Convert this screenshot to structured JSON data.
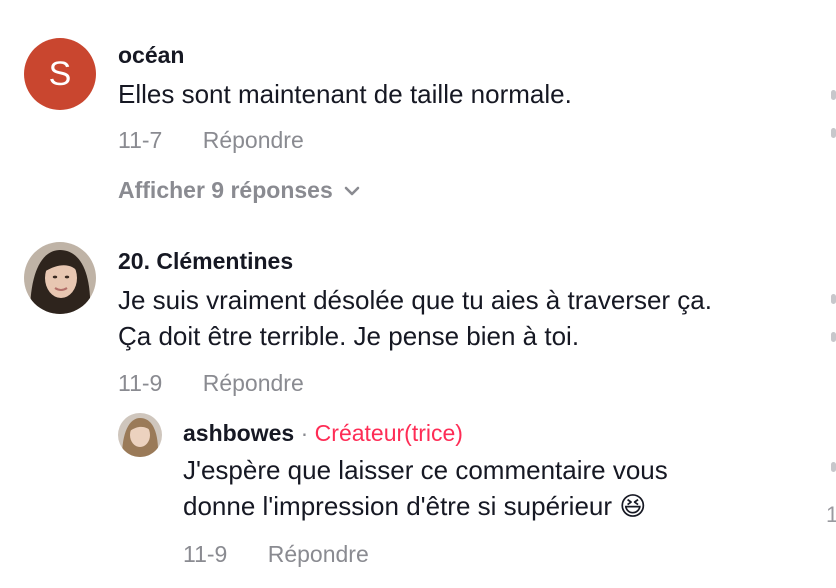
{
  "comments": [
    {
      "avatar_letter": "S",
      "username": "océan",
      "text": "Elles sont maintenant de taille normale.",
      "date": "11-7",
      "reply_label": "Répondre",
      "view_replies": "Afficher 9 réponses"
    },
    {
      "username": "20. Clémentines",
      "text_lines": [
        "Je suis vraiment désolée que tu aies à traverser ça.",
        "Ça doit être terrible. Je pense bien à toi."
      ],
      "date": "11-9",
      "reply_label": "Répondre",
      "reply": {
        "username": "ashbowes",
        "separator": "·",
        "badge": "Créateur(trice)",
        "text_lines": [
          "J'espère que laisser ce commentaire vous",
          "donne l'impression d'être si supérieur 😆"
        ],
        "date": "11-9",
        "reply_label": "Répondre"
      }
    }
  ],
  "edge_count_partial": "1",
  "colors": {
    "accent": "#fe2c55",
    "muted": "#8a8b91",
    "avatar_s": "#c9462f"
  }
}
